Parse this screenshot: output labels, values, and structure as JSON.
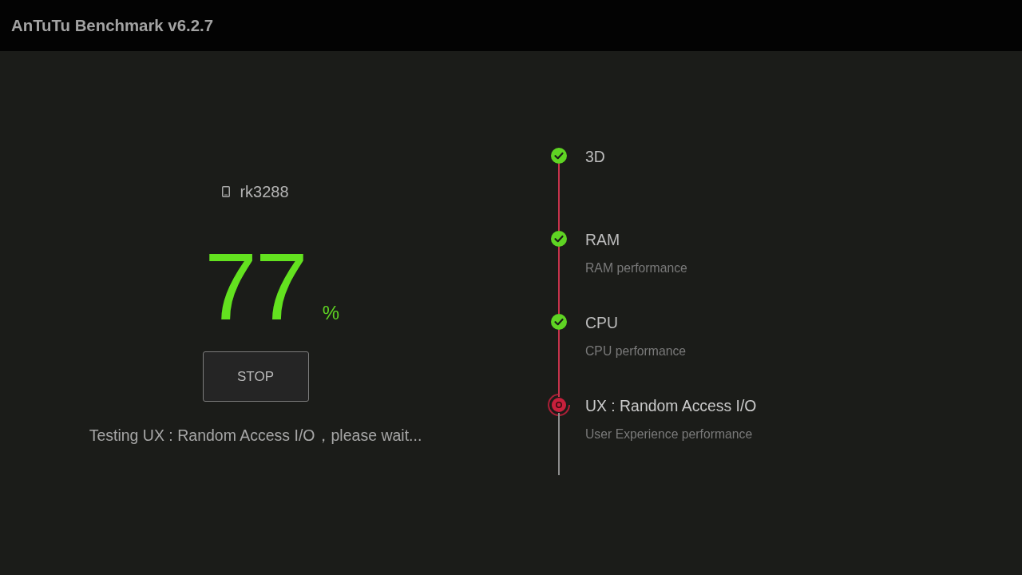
{
  "app_bar": {
    "title": "AnTuTu Benchmark v6.2.7"
  },
  "device": {
    "name": "rk3288"
  },
  "progress": {
    "value": "77",
    "unit": "%"
  },
  "stop_button": {
    "label": "STOP"
  },
  "status_message": "Testing UX : Random Access I/O，please wait...",
  "steps": [
    {
      "title": "3D",
      "kind": "done"
    },
    {
      "title": "RAM",
      "subtitle": "RAM performance",
      "kind": "done"
    },
    {
      "title": "CPU",
      "subtitle": "CPU performance",
      "kind": "done"
    },
    {
      "title": "UX : Random Access I/O",
      "subtitle": "User Experience performance",
      "kind": "running"
    }
  ]
}
